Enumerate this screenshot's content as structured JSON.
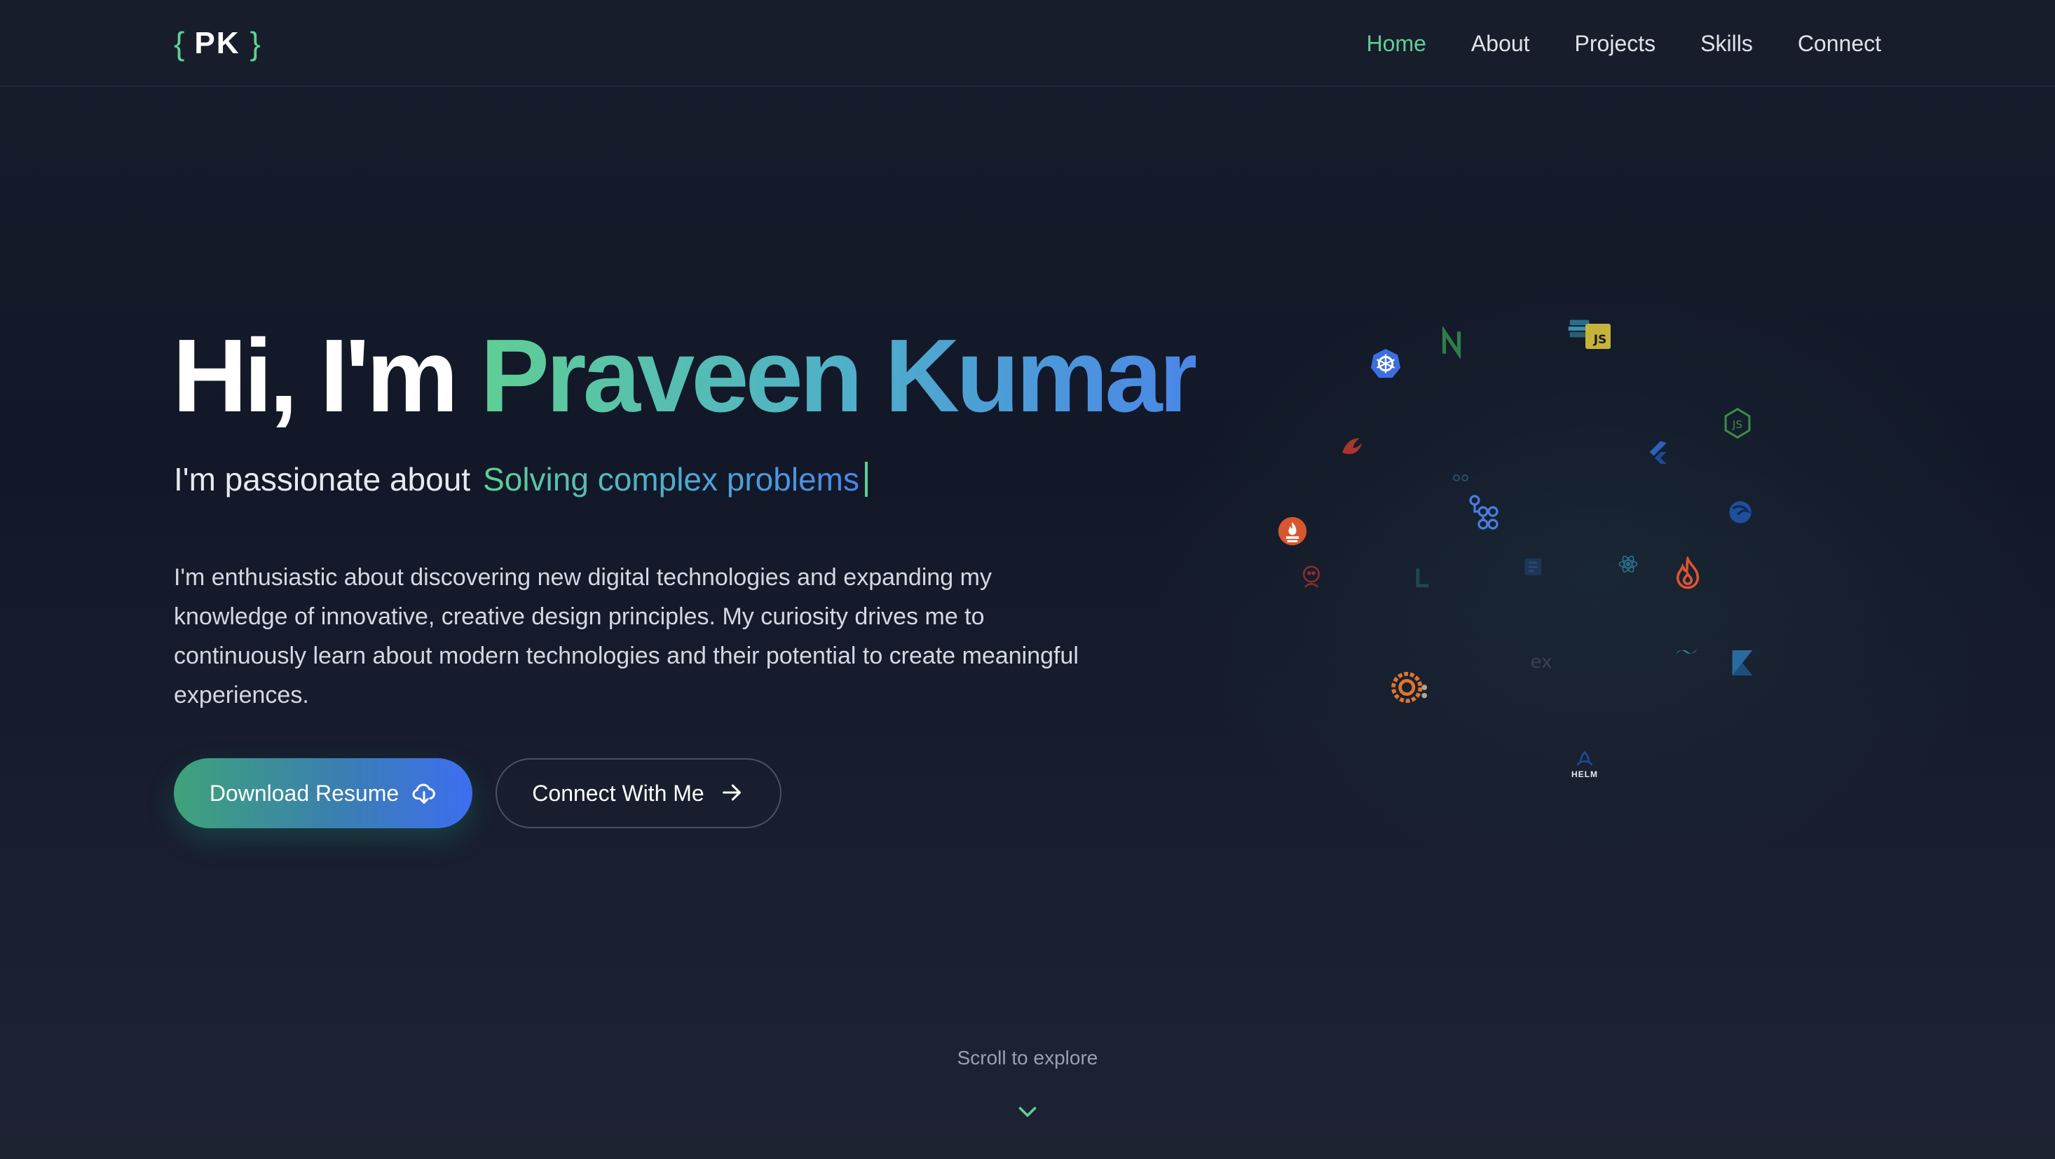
{
  "logo": {
    "open_brace": "{",
    "initials": "PK",
    "close_brace": "}"
  },
  "nav": {
    "items": [
      {
        "label": "Home",
        "active": true
      },
      {
        "label": "About",
        "active": false
      },
      {
        "label": "Projects",
        "active": false
      },
      {
        "label": "Skills",
        "active": false
      },
      {
        "label": "Connect",
        "active": false
      }
    ]
  },
  "hero": {
    "greeting": "Hi, I'm",
    "name": "Praveen Kumar",
    "tagline_lead": "I'm passionate about",
    "tagline_typed": "Solving complex problems",
    "intro": "I'm enthusiastic about discovering new digital technologies and expanding my knowledge of innovative, creative design principles. My curiosity drives me to continuously learn about modern technologies and their potential to create meaningful experiences.",
    "primary_button": "Download Resume",
    "secondary_button": "Connect With Me"
  },
  "tech_icons": {
    "js_badge": "JS",
    "express_label": "ex",
    "helm_label": "HELM",
    "names": [
      "kubernetes-icon",
      "nginx-icon",
      "elasticsearch-icon",
      "javascript-icon",
      "nodejs-icon",
      "rust-icon",
      "flutter-icon",
      "github-actions-icon",
      "postgresql-icon",
      "prometheus-icon",
      "debian-icon",
      "jenkins-icon",
      "storybook-icon",
      "ecs-icon",
      "react-icon",
      "firebase-icon",
      "grafana-icon",
      "express-icon",
      "tailwind-icon",
      "kotlin-icon",
      "helm-icon"
    ]
  },
  "scroll": {
    "label": "Scroll to explore"
  },
  "colors": {
    "accent_green": "#5fcf95",
    "accent_blue": "#4a86e8",
    "background": "#141a27"
  }
}
